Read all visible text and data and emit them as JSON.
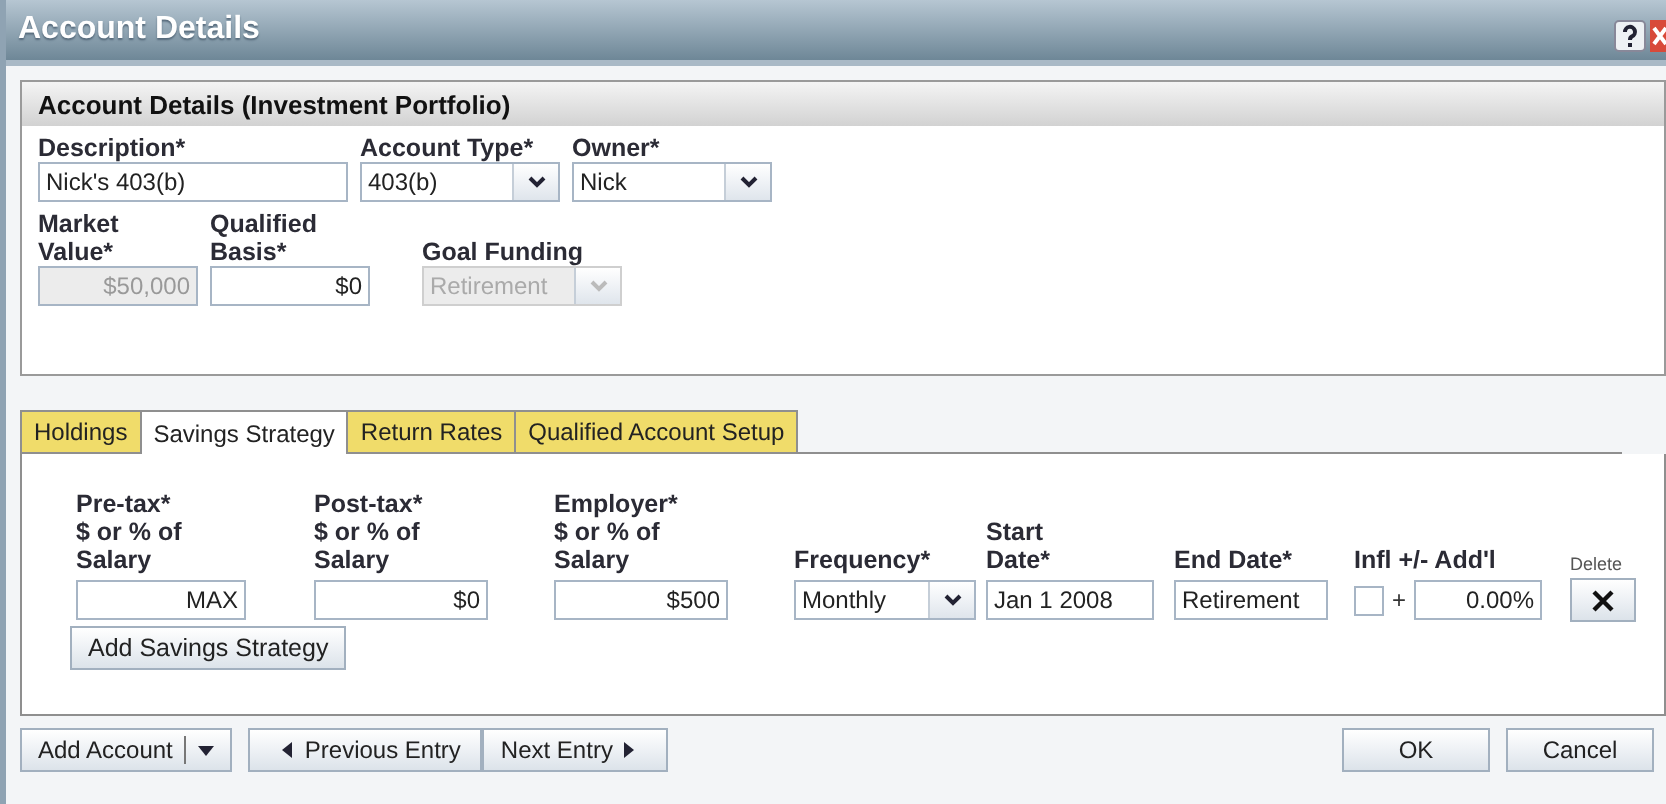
{
  "window": {
    "title": "Account Details"
  },
  "account_section": {
    "title": "Account Details (Investment Portfolio)",
    "top_fields": [
      {
        "label": "Description*",
        "value": "Nick's 403(b)",
        "kind": "text",
        "disabled": false
      },
      {
        "label": "Account Type*",
        "value": "403(b)",
        "kind": "select",
        "disabled": false
      },
      {
        "label": "Owner*",
        "value": "Nick",
        "kind": "select",
        "disabled": false
      }
    ],
    "bottom_fields": [
      {
        "label": "Market\nValue*",
        "value": "$50,000",
        "kind": "amount",
        "disabled": true
      },
      {
        "label": "Qualified\nBasis*",
        "value": "$0",
        "kind": "amount",
        "disabled": false
      },
      {
        "label": "Goal Funding",
        "value": "Retirement",
        "kind": "select",
        "disabled": true
      }
    ]
  },
  "tabs": [
    {
      "label": "Holdings",
      "selected": false
    },
    {
      "label": "Savings Strategy",
      "selected": true
    },
    {
      "label": "Return Rates",
      "selected": false
    },
    {
      "label": "Qualified Account Setup",
      "selected": false
    }
  ],
  "savings": {
    "columns": [
      {
        "header": "Pre-tax*\n$ or % of\nSalary",
        "value": "MAX",
        "kind": "amount"
      },
      {
        "header": "Post-tax*\n$ or % of\nSalary",
        "value": "$0",
        "kind": "amount"
      },
      {
        "header": "Employer*\n$ or % of\nSalary",
        "value": "$500",
        "kind": "amount"
      },
      {
        "header": "Frequency*",
        "value": "Monthly",
        "kind": "select"
      },
      {
        "header": "Start\nDate*",
        "value": "Jan 1 2008",
        "kind": "text"
      },
      {
        "header": "End Date*",
        "value": "Retirement",
        "kind": "text"
      },
      {
        "header": "Infl +/- Add'l",
        "value": "0.00%",
        "kind": "inflation",
        "checked": false,
        "sign": "+"
      },
      {
        "header": "Delete",
        "kind": "delete"
      }
    ],
    "add_button": "Add Savings Strategy"
  },
  "footer": {
    "left": [
      {
        "label": "Add Account",
        "kind": "split"
      },
      {
        "label": "Previous Entry",
        "kind": "prev"
      },
      {
        "label": "Next Entry",
        "kind": "next"
      }
    ],
    "right": [
      {
        "label": "OK",
        "kind": "plain"
      },
      {
        "label": "Cancel",
        "kind": "plain"
      }
    ]
  }
}
